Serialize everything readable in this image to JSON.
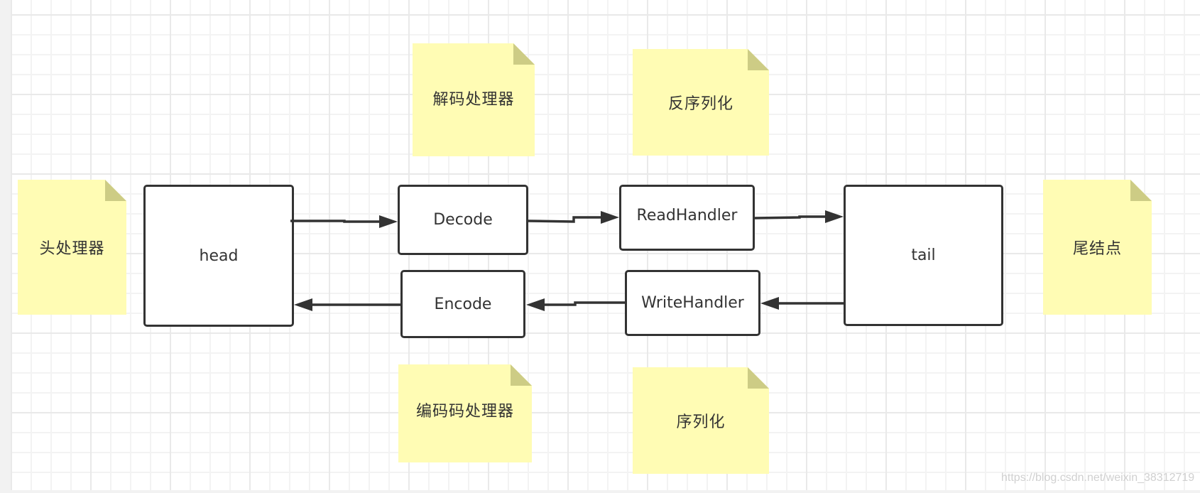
{
  "diagram": {
    "nodes": {
      "head": "head",
      "decode": "Decode",
      "encode": "Encode",
      "read_handler": "ReadHandler",
      "write_handler": "WriteHandler",
      "tail": "tail"
    },
    "notes": {
      "head_note": "头处理器",
      "decode_note": "解码处理器",
      "read_note": "反序列化",
      "encode_note": "编码码处理器",
      "write_note": "序列化",
      "tail_note": "尾结点"
    },
    "edges": [
      {
        "from": "head",
        "to": "Decode"
      },
      {
        "from": "Decode",
        "to": "ReadHandler"
      },
      {
        "from": "ReadHandler",
        "to": "tail"
      },
      {
        "from": "tail",
        "to": "WriteHandler"
      },
      {
        "from": "WriteHandler",
        "to": "Encode"
      },
      {
        "from": "Encode",
        "to": "head"
      }
    ],
    "colors": {
      "note_fill": "#fffcb4",
      "note_fold": "#cdcc85",
      "stroke": "#333333"
    }
  },
  "watermark": "https://blog.csdn.net/weixin_38312719"
}
